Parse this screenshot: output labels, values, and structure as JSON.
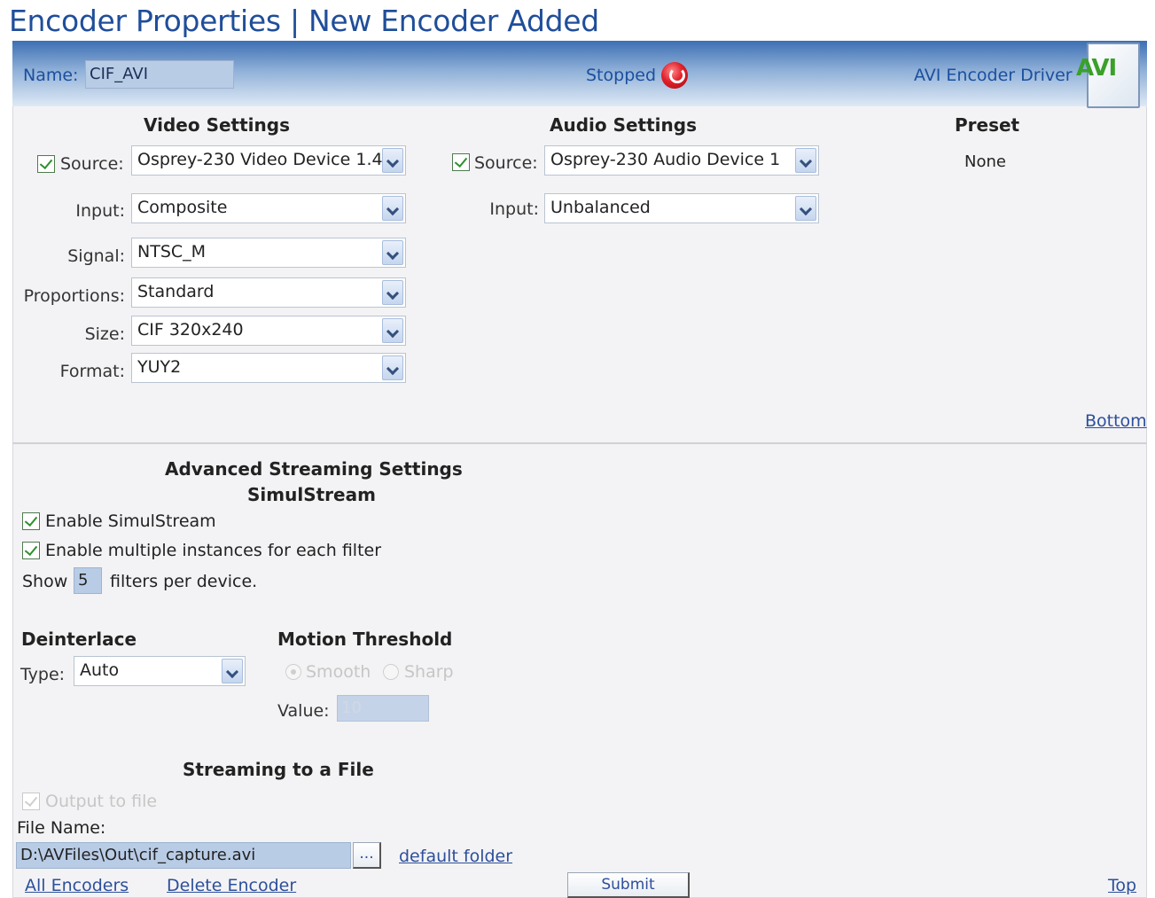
{
  "title": "Encoder Properties | New Encoder Added",
  "header": {
    "name_label": "Name:",
    "name_value": "CIF_AVI",
    "status": "Stopped",
    "driver": "AVI Encoder Driver",
    "badge": "AVI"
  },
  "video": {
    "heading": "Video Settings",
    "source_label": "Source:",
    "source_value": "Osprey-230 Video Device 1.4",
    "input_label": "Input:",
    "input_value": "Composite",
    "signal_label": "Signal:",
    "signal_value": "NTSC_M",
    "proportions_label": "Proportions:",
    "proportions_value": "Standard",
    "size_label": "Size:",
    "size_value": "CIF 320x240",
    "format_label": "Format:",
    "format_value": "YUY2"
  },
  "audio": {
    "heading": "Audio Settings",
    "source_label": "Source:",
    "source_value": "Osprey-230 Audio Device 1",
    "input_label": "Input:",
    "input_value": "Unbalanced"
  },
  "preset": {
    "heading": "Preset",
    "value": "None"
  },
  "links": {
    "bottom": "Bottom",
    "top": "Top",
    "all_encoders": "All Encoders",
    "delete_encoder": "Delete Encoder",
    "default_folder": "default folder"
  },
  "advanced": {
    "heading": "Advanced Streaming Settings",
    "simulstream_heading": "SimulStream",
    "enable_simulstream": "Enable SimulStream",
    "enable_multiple": "Enable multiple instances for each filter",
    "show_label": "Show",
    "show_value": "5",
    "filters_label": "filters per device."
  },
  "deinterlace": {
    "heading": "Deinterlace",
    "type_label": "Type:",
    "type_value": "Auto"
  },
  "motion": {
    "heading": "Motion Threshold",
    "smooth": "Smooth",
    "sharp": "Sharp",
    "value_label": "Value:",
    "value": "10"
  },
  "file": {
    "heading": "Streaming to a File",
    "output_label": "Output to file",
    "filename_label": "File Name:",
    "filename_value": "D:\\AVFiles\\Out\\cif_capture.avi",
    "browse": "..."
  },
  "submit_label": "Submit"
}
